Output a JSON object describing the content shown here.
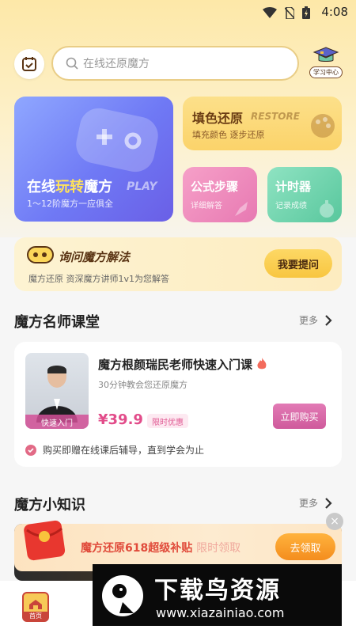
{
  "status": {
    "time": "4:08"
  },
  "header": {
    "search_placeholder": "在线还原魔方",
    "study_center_label": "学习中心"
  },
  "features": {
    "play": {
      "title_prefix": "在线",
      "title_highlight": "玩转",
      "title_suffix": "魔方",
      "title_en": "PLAY",
      "subtitle": "1～12阶魔方一应俱全"
    },
    "restore": {
      "title": "填色还原",
      "title_en": "RESTORE",
      "subtitle": "填充颜色 逐步还原"
    },
    "formula": {
      "title": "公式步骤",
      "subtitle": "详细解答"
    },
    "timer": {
      "title": "计时器",
      "subtitle": "记录成绩"
    }
  },
  "ask": {
    "title": "询问魔方解法",
    "subtitle": "魔方还原 资深魔方讲师1v1为您解答",
    "button": "我要提问"
  },
  "teachers_section": {
    "title": "魔方名师课堂",
    "more": "更多"
  },
  "course": {
    "teacher_tag": "快速入门",
    "title": "魔方根颜瑞民老师快速入门课",
    "subtitle": "30分钟教会您还原魔方",
    "price": "¥39.9",
    "badge": "限时优惠",
    "buy_button": "立即购买",
    "note": "购买即赠在线课后辅导，直到学会为止"
  },
  "knowledge_section": {
    "title": "魔方小知识",
    "more": "更多"
  },
  "promo": {
    "text": "魔方还原618超级补贴",
    "text_light": "限时领取",
    "button": "去领取"
  },
  "tabbar": {
    "home_label": "首页"
  },
  "watermark": {
    "title": "下载鸟资源",
    "url": "www.xiazainiao.com"
  }
}
